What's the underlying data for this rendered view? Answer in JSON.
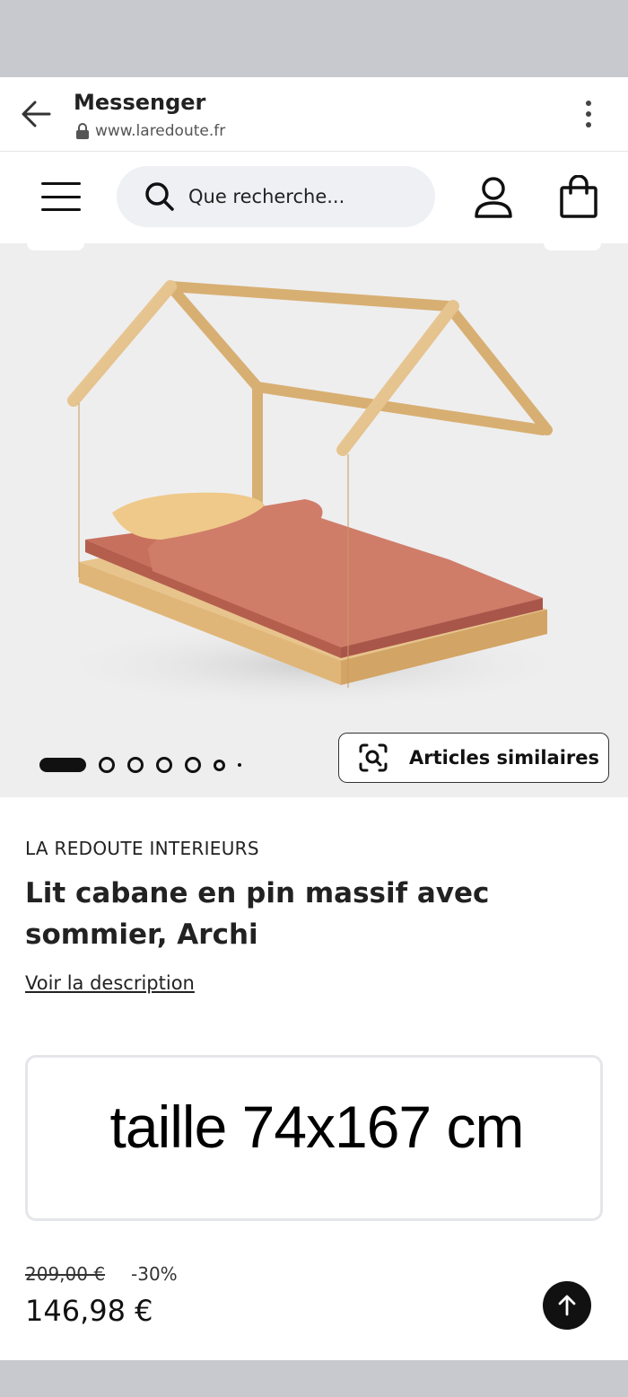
{
  "browser": {
    "title": "Messenger",
    "url": "www.laredoute.fr"
  },
  "header": {
    "search_placeholder": "Que recherche..."
  },
  "gallery": {
    "image_count": 7,
    "active_index": 0,
    "similar_button_label": "Articles similaires"
  },
  "product": {
    "brand": "LA REDOUTE INTERIEURS",
    "title": "Lit cabane en pin massif avec sommier, Archi",
    "description_link": "Voir la description",
    "size_text": "taille 74x167 cm",
    "old_price": "209,00 €",
    "discount": "-30%",
    "price": "146,98 €"
  },
  "colors": {
    "accent": "#111111",
    "wood": "#e8c48d",
    "bedding": "#c8705e",
    "pillow": "#efc98a"
  }
}
